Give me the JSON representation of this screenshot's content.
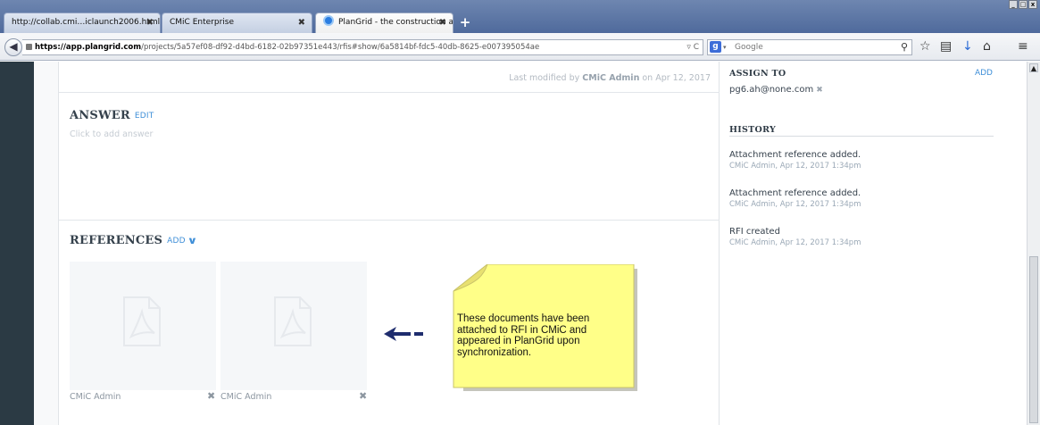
{
  "browser": {
    "tabs": [
      {
        "label": "http://collab.cmi…iclaunch2006.html"
      },
      {
        "label": "CMiC Enterprise"
      },
      {
        "label": "PlanGrid - the construction ap…"
      }
    ],
    "new_tab_icon": "plus-icon",
    "url_domain": "https://app.plangrid.com",
    "url_path": "/projects/5a57ef08-df92-d4bd-6182-02b97351e443/rfis#show/6a5814bf-fdc5-40db-8625-e007395054ae",
    "search_placeholder": "Google"
  },
  "main": {
    "last_modified_prefix": "Last modified by",
    "last_modified_by": "CMiC Admin",
    "last_modified_on": "on Apr 12, 2017",
    "answer": {
      "title": "ANSWER",
      "edit_label": "EDIT",
      "placeholder": "Click to add answer"
    },
    "references": {
      "title": "REFERENCES",
      "add_label": "ADD",
      "documents": [
        {
          "author": "CMiC Admin",
          "icon": "pdf-file-icon"
        },
        {
          "author": "CMiC Admin",
          "icon": "pdf-file-icon"
        }
      ]
    }
  },
  "sidebar": {
    "assign_title": "ASSIGN TO",
    "assign_add": "ADD",
    "assignee": "pg6.ah@none.com",
    "history_title": "HISTORY",
    "history": [
      {
        "text": "Attachment reference added.",
        "meta": "CMiC Admin, Apr 12, 2017 1:34pm"
      },
      {
        "text": "Attachment reference added.",
        "meta": "CMiC Admin, Apr 12, 2017 1:34pm"
      },
      {
        "text": "RFI created",
        "meta": "CMiC Admin, Apr 12, 2017 1:34pm"
      }
    ]
  },
  "annotation": {
    "text": "These documents have been attached to RFI in CMiC and appeared in PlanGrid upon synchronization.",
    "note_color": "#ffff88",
    "arrow_color": "#1f2d6e"
  }
}
